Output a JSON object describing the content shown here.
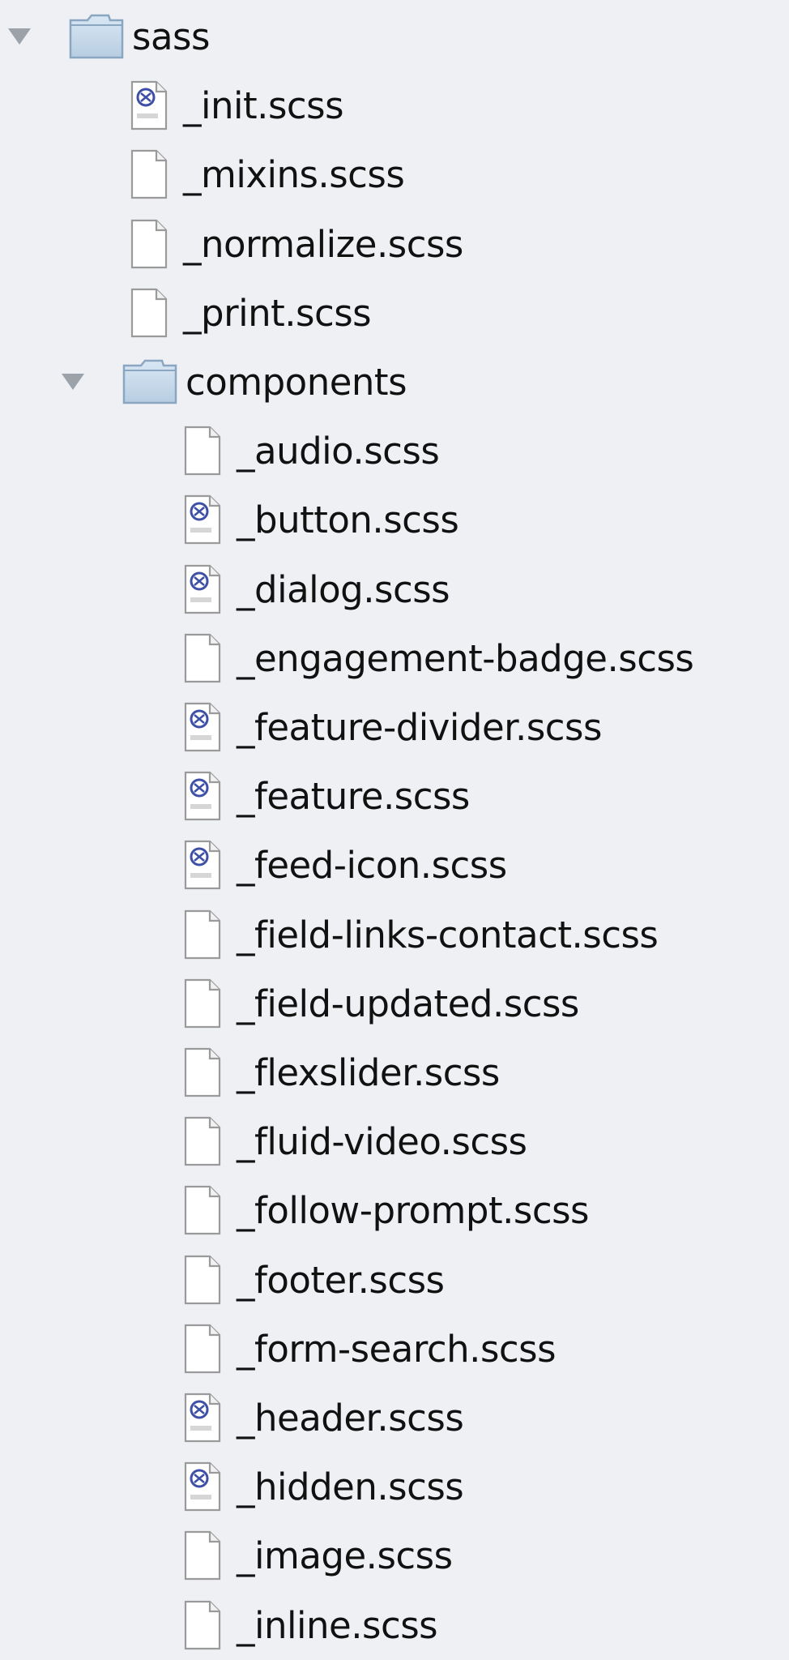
{
  "tree": [
    {
      "label": "sass",
      "kind": "folder",
      "expanded": true,
      "depth": 0
    },
    {
      "label": "_init.scss",
      "kind": "file",
      "icon": "sass-file-icon",
      "depth": 1
    },
    {
      "label": "_mixins.scss",
      "kind": "file",
      "icon": "blank-file-icon",
      "depth": 1
    },
    {
      "label": "_normalize.scss",
      "kind": "file",
      "icon": "blank-file-icon",
      "depth": 1
    },
    {
      "label": "_print.scss",
      "kind": "file",
      "icon": "blank-file-icon",
      "depth": 1
    },
    {
      "label": "components",
      "kind": "folder",
      "expanded": true,
      "depth": 1
    },
    {
      "label": "_audio.scss",
      "kind": "file",
      "icon": "blank-file-icon",
      "depth": 2
    },
    {
      "label": "_button.scss",
      "kind": "file",
      "icon": "sass-file-icon",
      "depth": 2
    },
    {
      "label": "_dialog.scss",
      "kind": "file",
      "icon": "sass-file-icon",
      "depth": 2
    },
    {
      "label": "_engagement-badge.scss",
      "kind": "file",
      "icon": "blank-file-icon",
      "depth": 2
    },
    {
      "label": "_feature-divider.scss",
      "kind": "file",
      "icon": "sass-file-icon",
      "depth": 2
    },
    {
      "label": "_feature.scss",
      "kind": "file",
      "icon": "sass-file-icon",
      "depth": 2
    },
    {
      "label": "_feed-icon.scss",
      "kind": "file",
      "icon": "sass-file-icon",
      "depth": 2
    },
    {
      "label": "_field-links-contact.scss",
      "kind": "file",
      "icon": "blank-file-icon",
      "depth": 2
    },
    {
      "label": "_field-updated.scss",
      "kind": "file",
      "icon": "blank-file-icon",
      "depth": 2
    },
    {
      "label": "_flexslider.scss",
      "kind": "file",
      "icon": "blank-file-icon",
      "depth": 2
    },
    {
      "label": "_fluid-video.scss",
      "kind": "file",
      "icon": "blank-file-icon",
      "depth": 2
    },
    {
      "label": "_follow-prompt.scss",
      "kind": "file",
      "icon": "blank-file-icon",
      "depth": 2
    },
    {
      "label": "_footer.scss",
      "kind": "file",
      "icon": "blank-file-icon",
      "depth": 2
    },
    {
      "label": "_form-search.scss",
      "kind": "file",
      "icon": "blank-file-icon",
      "depth": 2
    },
    {
      "label": "_header.scss",
      "kind": "file",
      "icon": "sass-file-icon",
      "depth": 2
    },
    {
      "label": "_hidden.scss",
      "kind": "file",
      "icon": "sass-file-icon",
      "depth": 2
    },
    {
      "label": "_image.scss",
      "kind": "file",
      "icon": "blank-file-icon",
      "depth": 2
    },
    {
      "label": "_inline.scss",
      "kind": "file",
      "icon": "blank-file-icon",
      "depth": 2
    }
  ],
  "colors": {
    "background": "#eef0f4",
    "text": "#111111",
    "disclosure": "#9ba2aa",
    "folder_light": "#d9e7f3",
    "folder_dark": "#8aa6c1",
    "sass_accent": "#3e4fa6"
  }
}
